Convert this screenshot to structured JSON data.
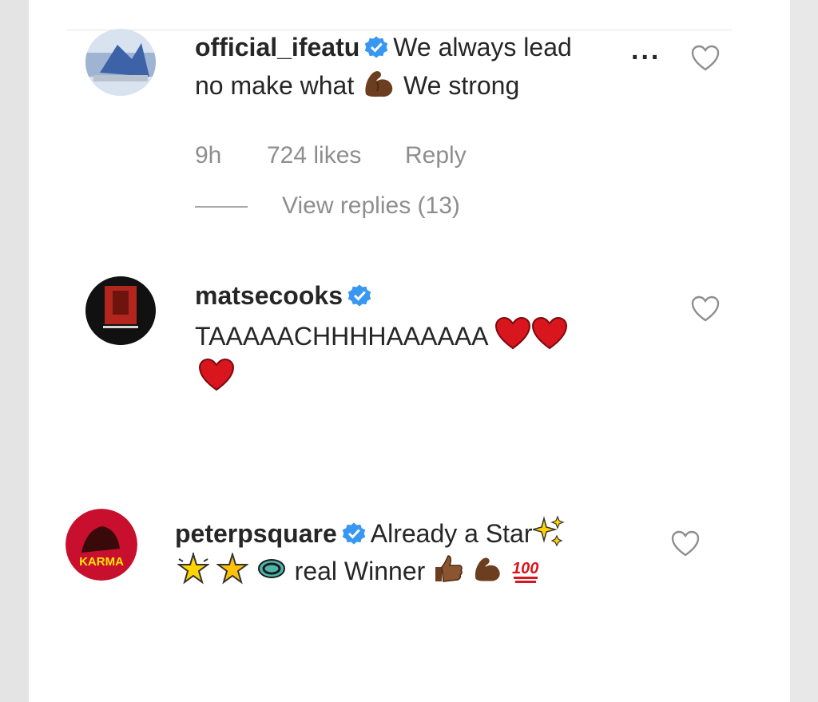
{
  "comments": [
    {
      "username": "official_ifeatu",
      "line1_text": "We always lead",
      "more": "...",
      "line2_a": "no make what",
      "line2_b": "We strong",
      "time": "9h",
      "likes": "724 likes",
      "reply": "Reply",
      "view_replies": "View replies (13)",
      "line1_emojis": [],
      "line2_emojis": [
        "flexed-biceps"
      ],
      "avatar_colors": [
        "#4a6fb0",
        "#c9d6ea"
      ]
    },
    {
      "username": "matsecooks",
      "line1": "TAAAAACHHHHAAAAAA",
      "line1_emojis": [
        "red-heart",
        "red-heart"
      ],
      "line2_emojis": [
        "red-heart"
      ],
      "avatar_colors": [
        "#111111",
        "#b3261e"
      ]
    },
    {
      "username": "peterpsquare",
      "line1": "Already a Star",
      "line1_emojis": [
        "sparkles"
      ],
      "line2_emojis_pre": [
        "glowing-star",
        "star",
        "repeat"
      ],
      "line2": "real Winner",
      "line2_emojis_post": [
        "thumbs-up",
        "flexed-biceps",
        "hundred-points"
      ],
      "avatar_colors": [
        "#c8102e",
        "#ffe600"
      ],
      "avatar_text": "KARMA"
    }
  ],
  "colors": {
    "verified": "#3897f0",
    "text": "#262626",
    "meta": "#8e8e8e",
    "heart_red": "#d9151e",
    "skin_brown": "#6b3e1f"
  }
}
